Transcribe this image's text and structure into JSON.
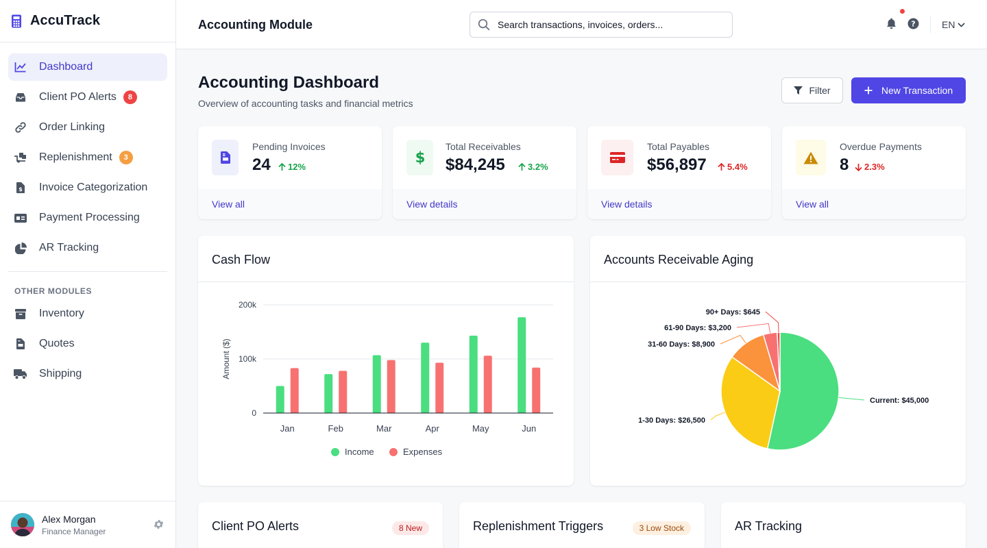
{
  "brand": {
    "name": "AccuTrack"
  },
  "sidebar": {
    "items": [
      {
        "label": "Dashboard",
        "icon": "chart-line-icon"
      },
      {
        "label": "Client PO Alerts",
        "icon": "inbox-icon",
        "badge": "8"
      },
      {
        "label": "Order Linking",
        "icon": "link-icon"
      },
      {
        "label": "Replenishment",
        "icon": "truck-loading-icon",
        "badge": "3"
      },
      {
        "label": "Invoice Categorization",
        "icon": "file-invoice-dollar-icon"
      },
      {
        "label": "Payment Processing",
        "icon": "money-check-icon"
      },
      {
        "label": "AR Tracking",
        "icon": "pie-chart-icon"
      }
    ],
    "other_section": "OTHER MODULES",
    "other_items": [
      {
        "label": "Inventory",
        "icon": "box-icon"
      },
      {
        "label": "Quotes",
        "icon": "file-invoice-icon"
      },
      {
        "label": "Shipping",
        "icon": "truck-icon"
      }
    ]
  },
  "user": {
    "name": "Alex Morgan",
    "role": "Finance Manager"
  },
  "header": {
    "title": "Accounting Module",
    "search_placeholder": "Search transactions, invoices, orders...",
    "language": "EN"
  },
  "page": {
    "title": "Accounting Dashboard",
    "subtitle": "Overview of accounting tasks and financial metrics",
    "filter_label": "Filter",
    "new_label": "New Transaction"
  },
  "stats": [
    {
      "label": "Pending Invoices",
      "value": "24",
      "change": "12%",
      "direction": "up",
      "link": "View all",
      "icon": "file-invoice-icon",
      "color": "#4f46e5"
    },
    {
      "label": "Total Receivables",
      "value": "$84,245",
      "change": "3.2%",
      "direction": "up",
      "link": "View details",
      "icon": "dollar-icon",
      "color": "#16a34a"
    },
    {
      "label": "Total Payables",
      "value": "$56,897",
      "change": "5.4%",
      "direction": "up",
      "link": "View details",
      "icon": "credit-card-icon",
      "color": "#dc2626"
    },
    {
      "label": "Overdue Payments",
      "value": "8",
      "change": "2.3%",
      "direction": "down",
      "link": "View all",
      "icon": "warning-icon",
      "color": "#ca8a04"
    }
  ],
  "panels": {
    "cash_flow_title": "Cash Flow",
    "ar_aging_title": "Accounts Receivable Aging",
    "po_alerts": {
      "title": "Client PO Alerts",
      "badge": "8 New"
    },
    "replenishment": {
      "title": "Replenishment Triggers",
      "badge": "3 Low Stock"
    },
    "ar_tracking": {
      "title": "AR Tracking"
    }
  },
  "chart_data": [
    {
      "type": "bar",
      "categories": [
        "Jan",
        "Feb",
        "Mar",
        "Apr",
        "May",
        "Jun"
      ],
      "series": [
        {
          "name": "Income",
          "values": [
            50000,
            72000,
            107000,
            130000,
            143000,
            177000
          ],
          "color": "#4ade80"
        },
        {
          "name": "Expenses",
          "values": [
            83000,
            78000,
            98000,
            93000,
            106000,
            84000
          ],
          "color": "#f87171"
        }
      ],
      "ylabel": "Amount ($)",
      "ylim": [
        0,
        200000
      ],
      "yticks": [
        "0",
        "100k",
        "200k"
      ],
      "legend": "bottom"
    },
    {
      "type": "pie",
      "labels": [
        "Current",
        "1-30 Days",
        "31-60 Days",
        "61-90 Days",
        "90+ Days"
      ],
      "values": [
        45000,
        26500,
        8900,
        3200,
        645
      ],
      "slice_labels": [
        "Current: $45,000",
        "1-30 Days: $26,500",
        "31-60 Days: $8,900",
        "61-90 Days: $3,200",
        "90+ Days: $645"
      ],
      "colors": [
        "#4ade80",
        "#facc15",
        "#fb923c",
        "#f87171",
        "#ef4444"
      ]
    }
  ]
}
